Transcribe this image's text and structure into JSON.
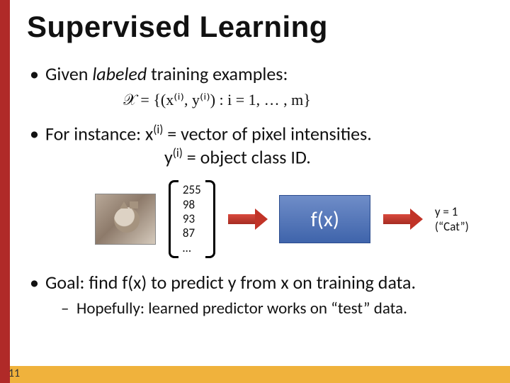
{
  "page_number": "11",
  "title": "Supervised Learning",
  "bullets": {
    "b1_pre": "Given ",
    "b1_italic": "labeled",
    "b1_post": " training examples:",
    "math_set": "𝒳 = {(x⁽ⁱ⁾, y⁽ⁱ⁾) : i = 1, … , m}",
    "b2_pre": "For instance:  x",
    "b2_sup1": "(i)",
    "b2_mid": " = vector of pixel intensities.",
    "b2_line2_pre": "y",
    "b2_sup2": "(i)",
    "b2_line2_post": " = object class ID.",
    "b3": "Goal:  find f(x) to predict y from x on training data.",
    "sub1": "Hopefully:  learned predictor works on “test” data."
  },
  "vector": {
    "v0": "255",
    "v1": "98",
    "v2": "93",
    "v3": "87",
    "v4": "…"
  },
  "fx_label": "f(x)",
  "output_label": "y = 1   (“Cat”)"
}
